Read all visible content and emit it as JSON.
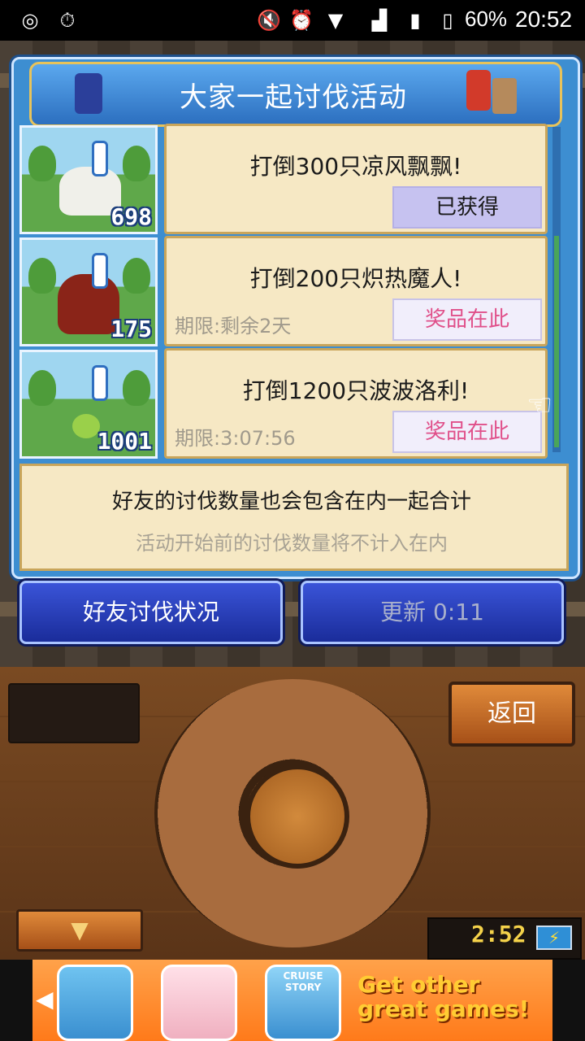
{
  "status_bar": {
    "battery": "60%",
    "time": "20:52"
  },
  "header": {
    "title": "大家一起讨伐活动"
  },
  "quests": [
    {
      "count": "698",
      "text": "打倒300只凉风飘飘!",
      "deadline": "",
      "button": "已获得"
    },
    {
      "count": "175",
      "text": "打倒200只炽热魔人!",
      "deadline": "期限:剩余2天",
      "button": "奖品在此"
    },
    {
      "count": "1001",
      "text": "打倒1200只波波洛利!",
      "deadline": "期限:3:07:56",
      "button": "奖品在此"
    }
  ],
  "notice": {
    "line1": "好友的讨伐数量也会包含在内一起合计",
    "line2": "活动开始前的讨伐数量将不计入在内"
  },
  "buttons": {
    "friend_status": "好友讨伐状况",
    "refresh": "更新 0:11",
    "back": "返回"
  },
  "console": {
    "clock": "2:52"
  },
  "ad": {
    "cruise_label": "CRUISE STORY",
    "title": "Get other great games!"
  }
}
